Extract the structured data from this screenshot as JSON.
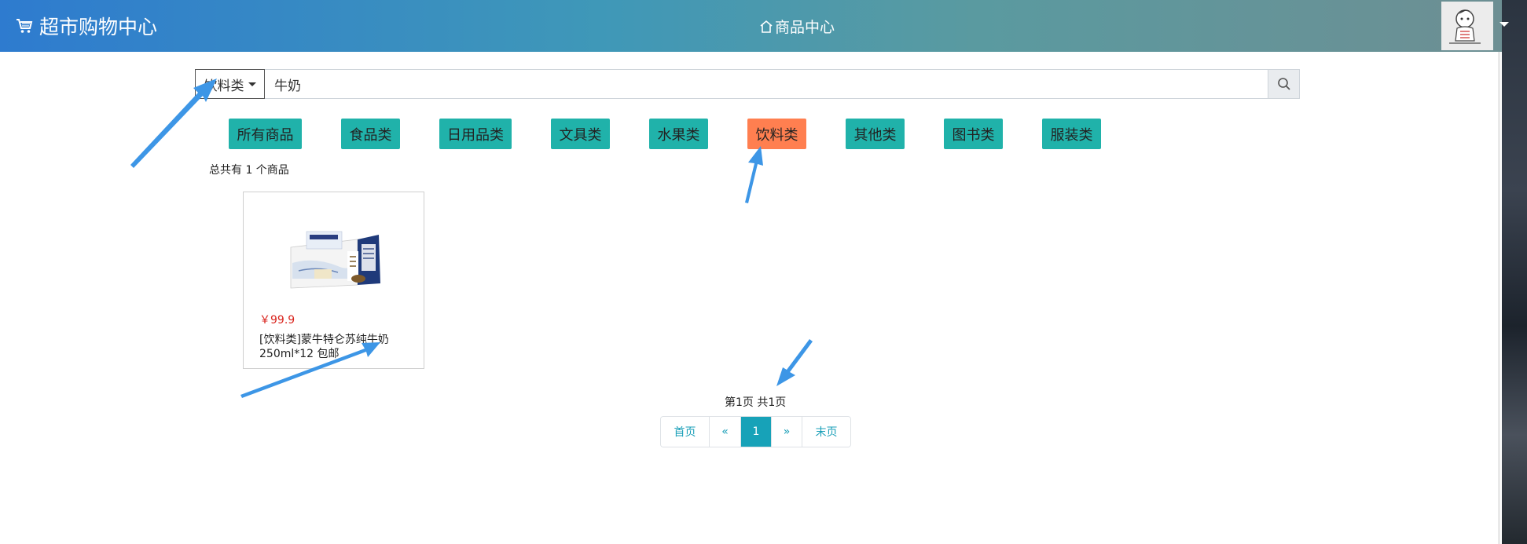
{
  "header": {
    "brand": "超市购物中心",
    "center_title": "商品中心"
  },
  "search": {
    "category": "饮料类",
    "query": "牛奶"
  },
  "categories": [
    "所有商品",
    "食品类",
    "日用品类",
    "文具类",
    "水果类",
    "饮料类",
    "其他类",
    "图书类",
    "服装类"
  ],
  "active_category": "饮料类",
  "total_text": "总共有 1 个商品",
  "product": {
    "price": "￥99.9",
    "name": "[饮料类]蒙牛特仑苏纯牛奶250ml*12 包邮"
  },
  "pagination": {
    "info": "第1页 共1页",
    "first": "首页",
    "prev": "«",
    "current": "1",
    "next": "»",
    "last": "末页"
  },
  "colors": {
    "category_button": "#20b2aa",
    "active_category_button": "#ff7f50",
    "price": "#d9241d",
    "pager_active": "#17a2b8",
    "arrow": "#3d96e6"
  }
}
